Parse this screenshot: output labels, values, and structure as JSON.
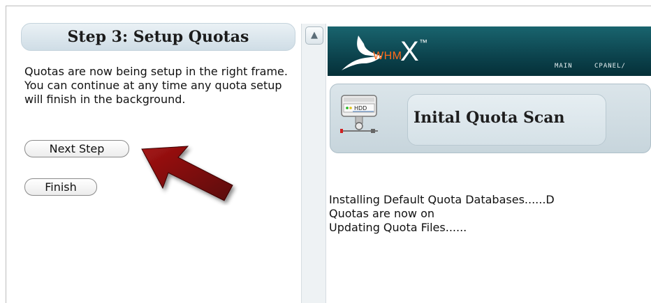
{
  "left_frame": {
    "title": "Step 3: Setup Quotas",
    "description": "Quotas are now being setup in the right frame. You can continue at any time any quota setup will finish in the background.",
    "next_button": "Next Step",
    "finish_button": "Finish",
    "arrow_color": "#7a0a0a"
  },
  "scrollbar": {
    "up_glyph": "▲"
  },
  "right_frame": {
    "logo": {
      "whm": "WHM",
      "x": "X",
      "tm": "™"
    },
    "nav": {
      "main": "MAIN",
      "cpanel": "CPANEL/"
    },
    "scan_panel": {
      "icon": "hdd-icon",
      "icon_label": "HDD",
      "title": "Inital Quota Scan"
    },
    "log_lines": [
      "Installing Default Quota Databases......D",
      "Quotas are now on",
      "Updating Quota Files......"
    ]
  },
  "colors": {
    "header_bg": "#0a3e48",
    "whm_orange": "#ff6a1a",
    "panel_bg": "#cfdde6"
  }
}
